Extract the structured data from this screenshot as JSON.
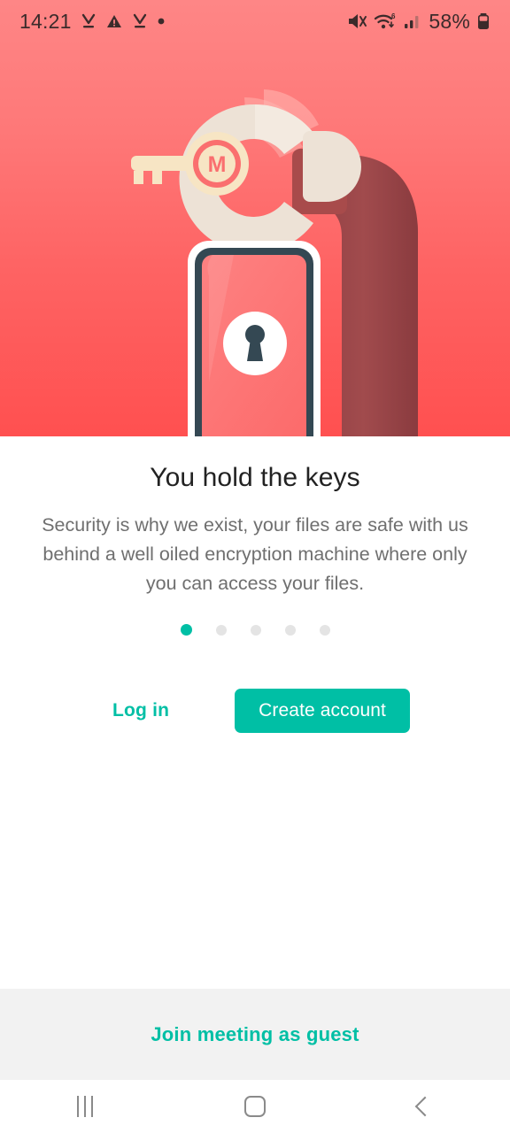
{
  "status_bar": {
    "time": "14:21",
    "battery_percent": "58%",
    "left_icons": [
      "download-complete-icon",
      "warning-triangle-icon",
      "download-complete-icon",
      "dot-indicator-icon"
    ],
    "right_icons": [
      "mute-vibrate-icon",
      "wifi-6-icon",
      "cellular-signal-icon",
      "battery-icon"
    ]
  },
  "hero": {
    "illustration_name": "handcuff-key-phone-illustration",
    "key_logo_letter": "M",
    "colors": {
      "bg_top": "#FE8686",
      "bg_bottom": "#FF5050",
      "cuff": "#EFE4DA",
      "arm": "#9E4548",
      "arm_cuff": "#A84B4B",
      "key": "#F7E5C4",
      "phone_frame": "#FFFFFF",
      "phone_bezel": "#344853",
      "phone_screen": "#FD7373"
    }
  },
  "onboarding": {
    "title": "You hold the keys",
    "description": "Security is why we exist, your files are safe with us behind a well oiled encryption machine where only you can access your files.",
    "pager": {
      "total": 5,
      "active_index": 0,
      "active_color": "#00BFA5",
      "inactive_color": "#E4E4E4"
    }
  },
  "actions": {
    "login_label": "Log in",
    "create_account_label": "Create account",
    "accent_color": "#00BFA5"
  },
  "guest_bar": {
    "join_meeting_label": "Join meeting as guest",
    "background": "#F2F2F2"
  },
  "nav_bar": {
    "recents_name": "recents-icon",
    "home_name": "home-icon",
    "back_name": "back-icon"
  }
}
